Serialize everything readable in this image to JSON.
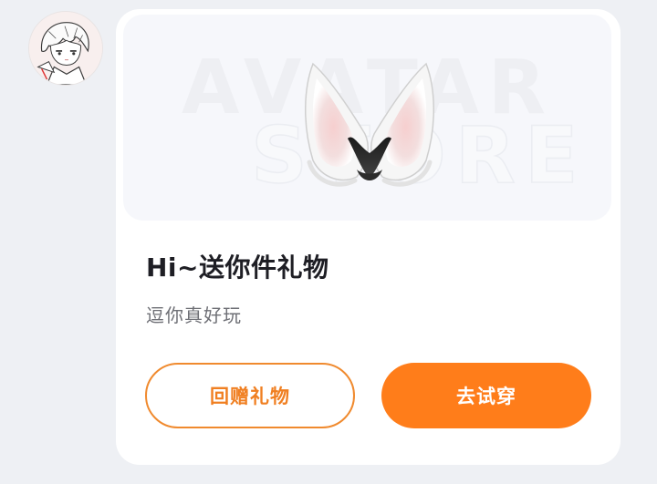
{
  "sender": {
    "avatar_icon": "anime-avatar-icon"
  },
  "gift_card": {
    "item_image": "cat-ears-icon",
    "watermark_line1": "AVATAR",
    "watermark_line2": "STORE",
    "title": "Hi~送你件礼物",
    "message": "逗你真好玩",
    "return_gift_label": "回赠礼物",
    "try_on_label": "去试穿"
  },
  "colors": {
    "accent": "#ff7d1a",
    "outline_button": "#f08a2e",
    "title_text": "#1e1e24",
    "secondary_text": "#6e6f75"
  }
}
